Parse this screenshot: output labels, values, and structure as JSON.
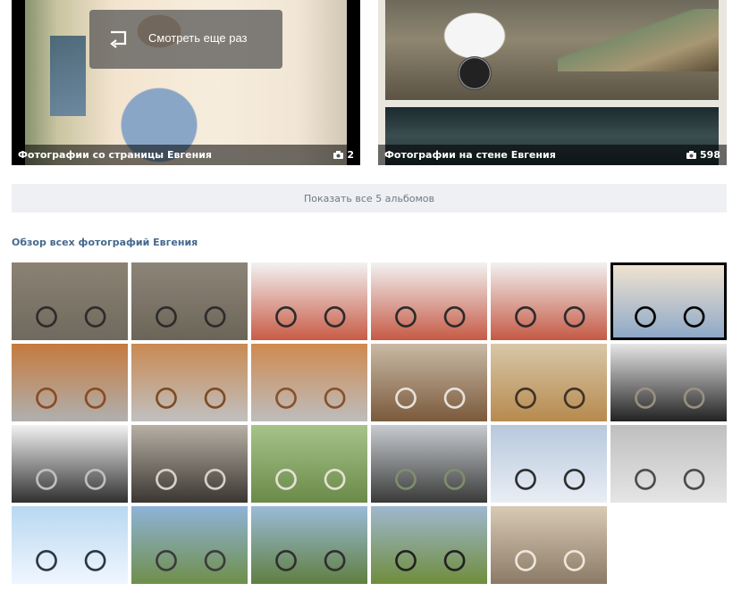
{
  "albums": [
    {
      "title": "Фотографии со страницы Евгения",
      "count": "2",
      "replay_label": "Смотреть еще раз"
    },
    {
      "title": "Фотографии на стене Евгения",
      "count": "598"
    }
  ],
  "show_all_label": "Показать все 5 альбомов",
  "section_title": "Обзор всех фотографий Евгения",
  "icons": {
    "replay": "replay-icon",
    "camera": "camera-icon"
  },
  "photos": [
    {
      "subject": "black bike in forest",
      "colors": [
        "#8b8273",
        "#6f6a5e",
        "#2b2b2b"
      ]
    },
    {
      "subject": "black bike in forest",
      "colors": [
        "#8d8478",
        "#6b6558",
        "#2b2b2b"
      ]
    },
    {
      "subject": "black bike on brick floor",
      "colors": [
        "#f2f2f2",
        "#c85b46",
        "#2a2a2a"
      ]
    },
    {
      "subject": "black bike on brick floor",
      "colors": [
        "#f2f2f2",
        "#c65a45",
        "#2a2a2a"
      ]
    },
    {
      "subject": "black bike on brick floor",
      "colors": [
        "#f1f1f1",
        "#c55944",
        "#2a2a2a"
      ]
    },
    {
      "subject": "portrait of man",
      "colors": [
        "#f3e5d1",
        "#8aa6c7",
        "#000000"
      ]
    },
    {
      "subject": "bike frame closeup",
      "colors": [
        "#c57a3d",
        "#b0b0b0",
        "#8a4a20"
      ]
    },
    {
      "subject": "bike frame closeup",
      "colors": [
        "#c98a52",
        "#c0c0c0",
        "#7c4a22"
      ]
    },
    {
      "subject": "bike frame closeup",
      "colors": [
        "#cf8a50",
        "#bdbdbd",
        "#86502a"
      ]
    },
    {
      "subject": "part closeup",
      "colors": [
        "#c9b9a5",
        "#7a5a3c",
        "#e8e2da"
      ]
    },
    {
      "subject": "bike frame closeup",
      "colors": [
        "#d8c7a8",
        "#b78a4e",
        "#3d3226"
      ]
    },
    {
      "subject": "bike indoors",
      "colors": [
        "#e6e6e6",
        "#222222",
        "#9a8f82"
      ]
    },
    {
      "subject": "bike indoors",
      "colors": [
        "#f2f2f2",
        "#303030",
        "#c0c0c0"
      ]
    },
    {
      "subject": "man with camera",
      "colors": [
        "#b8b0a5",
        "#3a3631",
        "#d8d2c8"
      ]
    },
    {
      "subject": "white bike outdoors",
      "colors": [
        "#a6c48a",
        "#6a8a48",
        "#e6e2d8"
      ]
    },
    {
      "subject": "bike in yard",
      "colors": [
        "#c8ccd0",
        "#3a3a3a",
        "#7d8f6b"
      ]
    },
    {
      "subject": "bike in snow",
      "colors": [
        "#b8c8dc",
        "#e8eef5",
        "#2c2c2c"
      ]
    },
    {
      "subject": "silver bike",
      "colors": [
        "#bfbfbf",
        "#e5e5e5",
        "#4a4a4a"
      ]
    },
    {
      "subject": "bike in snow",
      "colors": [
        "#b8d8f0",
        "#f0f6ff",
        "#2b3540"
      ]
    },
    {
      "subject": "bike by river",
      "colors": [
        "#8fb3d8",
        "#6f8f4a",
        "#3a3a3a"
      ]
    },
    {
      "subject": "bike by river",
      "colors": [
        "#9bbbd8",
        "#5f7f40",
        "#2e2e2e"
      ]
    },
    {
      "subject": "bike on grass",
      "colors": [
        "#9fb8cf",
        "#6f8d3c",
        "#202020"
      ]
    },
    {
      "subject": "two bikes indoors",
      "colors": [
        "#d9cab6",
        "#8a7a66",
        "#efe7dc"
      ]
    }
  ]
}
